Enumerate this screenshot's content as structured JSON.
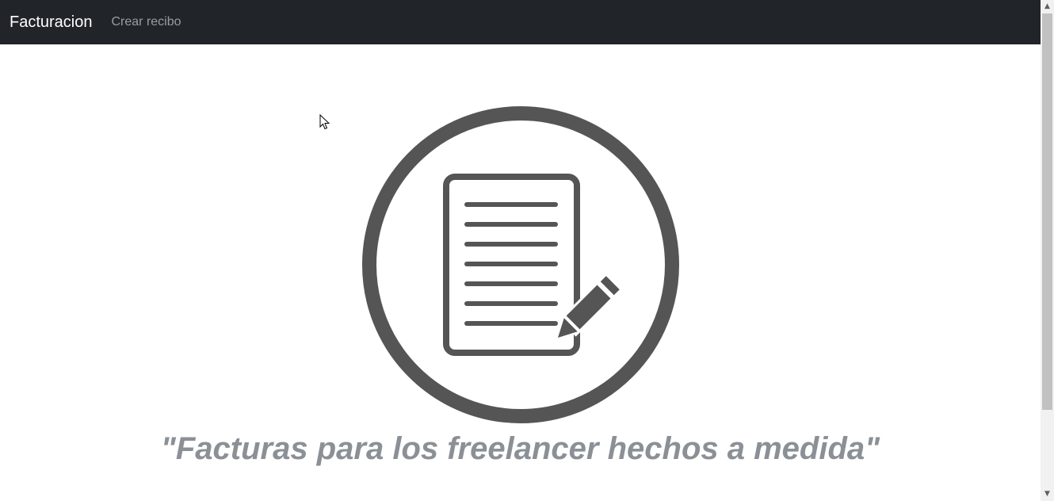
{
  "navbar": {
    "brand": "Facturacion",
    "links": [
      {
        "label": "Crear recibo"
      }
    ]
  },
  "hero": {
    "icon": "document-edit-icon",
    "tagline": "\"Facturas para los freelancer hechos a medida\""
  },
  "colors": {
    "navbar_bg": "#212529",
    "brand_text": "#ffffff",
    "nav_link_text": "#9a9da0",
    "icon_fill": "#555555",
    "tagline_text": "#8b9096"
  }
}
